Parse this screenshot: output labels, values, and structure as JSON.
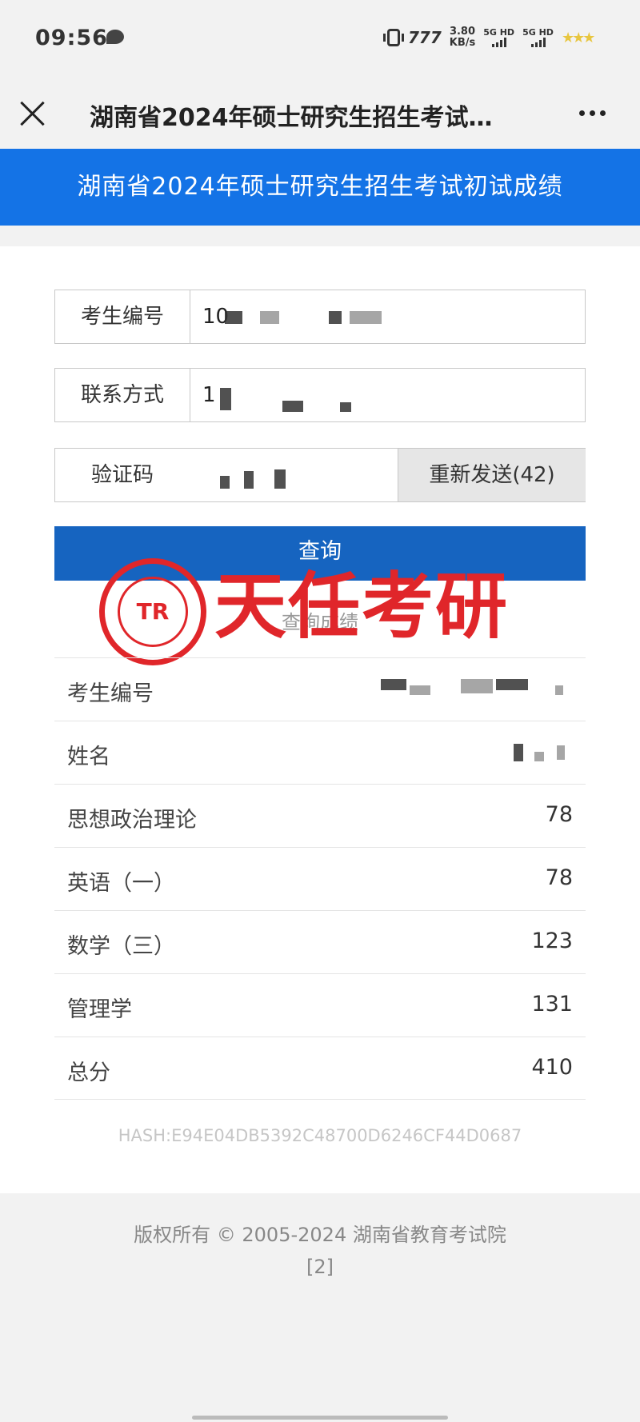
{
  "status_bar": {
    "time": "09:56",
    "carrier": "777",
    "speed_value": "3.80",
    "speed_unit": "KB/s",
    "signal1": "5G HD",
    "signal2": "5G HD",
    "icons": [
      "chat-bubble-icon",
      "vibrate-icon",
      "signal-bars-icon",
      "star-icon"
    ]
  },
  "header": {
    "title": "湖南省2024年硕士研究生招生考试…",
    "close_icon": "close-icon",
    "more_icon": "more-icon"
  },
  "banner": {
    "text": "湖南省2024年硕士研究生招生考试初试成绩"
  },
  "form": {
    "exam_id_label": "考生编号",
    "exam_id_value": "10",
    "contact_label": "联系方式",
    "contact_value": "1",
    "captcha_label": "验证码",
    "resend_label": "重新发送(42)",
    "query_label": "查询"
  },
  "watermark": {
    "seal_letters": "TR",
    "text": "天任考研"
  },
  "results": {
    "title": "查询成绩",
    "rows": [
      {
        "label": "考生编号",
        "value": ""
      },
      {
        "label": "姓名",
        "value": ""
      },
      {
        "label": "思想政治理论",
        "value": "78"
      },
      {
        "label": "英语（一）",
        "value": "78"
      },
      {
        "label": "数学（三）",
        "value": "123"
      },
      {
        "label": "管理学",
        "value": "131"
      },
      {
        "label": "总分",
        "value": "410"
      }
    ],
    "hash": "HASH:E94E04DB5392C48700D6246CF44D0687"
  },
  "footer": {
    "copyright": "版权所有 © 2005-2024 湖南省教育考试院",
    "page_marker": "[2]"
  }
}
